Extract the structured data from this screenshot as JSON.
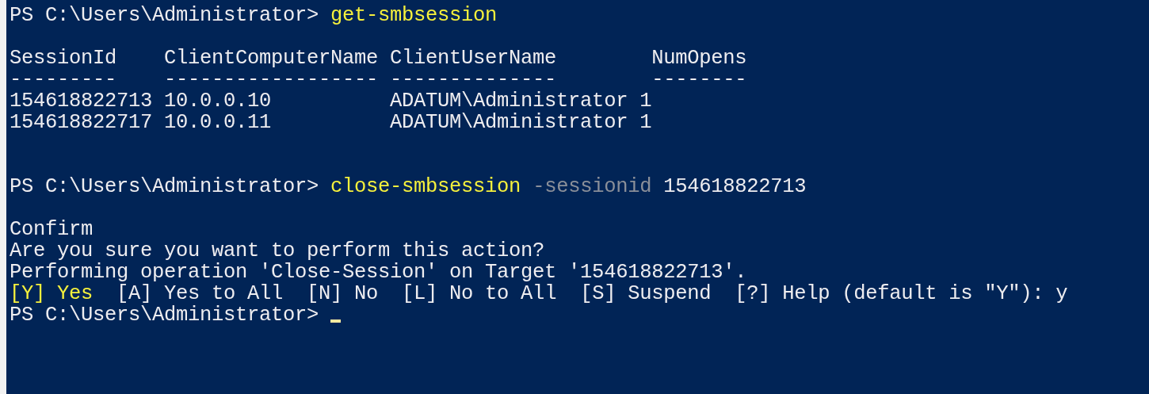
{
  "console": {
    "lines": [
      {
        "kind": "text",
        "segments": [
          {
            "kind": "prompt",
            "text": "PS C:\\Users\\Administrator> "
          },
          {
            "kind": "command",
            "text": "get-smbsession"
          }
        ]
      },
      {
        "kind": "blank"
      },
      {
        "kind": "text",
        "segments": [
          {
            "kind": "output",
            "text": "SessionId    ClientComputerName ClientUserName        NumOpens"
          }
        ]
      },
      {
        "kind": "text",
        "segments": [
          {
            "kind": "output",
            "text": "---------    ------------------ --------------        --------"
          }
        ]
      },
      {
        "kind": "text",
        "segments": [
          {
            "kind": "output",
            "text": "154618822713 10.0.0.10          ADATUM\\Administrator 1"
          }
        ]
      },
      {
        "kind": "text",
        "segments": [
          {
            "kind": "output",
            "text": "154618822717 10.0.0.11          ADATUM\\Administrator 1"
          }
        ]
      },
      {
        "kind": "blank"
      },
      {
        "kind": "blank"
      },
      {
        "kind": "text",
        "segments": [
          {
            "kind": "prompt",
            "text": "PS C:\\Users\\Administrator> "
          },
          {
            "kind": "command",
            "text": "close-smbsession"
          },
          {
            "kind": "parameter",
            "text": " -sessionid"
          },
          {
            "kind": "output",
            "text": " 154618822713"
          }
        ]
      },
      {
        "kind": "blank"
      },
      {
        "kind": "text",
        "segments": [
          {
            "kind": "output",
            "text": "Confirm"
          }
        ]
      },
      {
        "kind": "text",
        "segments": [
          {
            "kind": "output",
            "text": "Are you sure you want to perform this action?"
          }
        ]
      },
      {
        "kind": "text",
        "segments": [
          {
            "kind": "output",
            "text": "Performing operation 'Close-Session' on Target '154618822713'."
          }
        ]
      },
      {
        "kind": "text",
        "segments": [
          {
            "kind": "choice",
            "text": "[Y] Yes"
          },
          {
            "kind": "output",
            "text": "  [A] Yes to All  [N] No  [L] No to All  [S] Suspend  [?] Help (default is \"Y\"): y"
          }
        ]
      },
      {
        "kind": "text",
        "cursor": true,
        "segments": [
          {
            "kind": "prompt",
            "text": "PS C:\\Users\\Administrator> "
          }
        ]
      }
    ]
  }
}
